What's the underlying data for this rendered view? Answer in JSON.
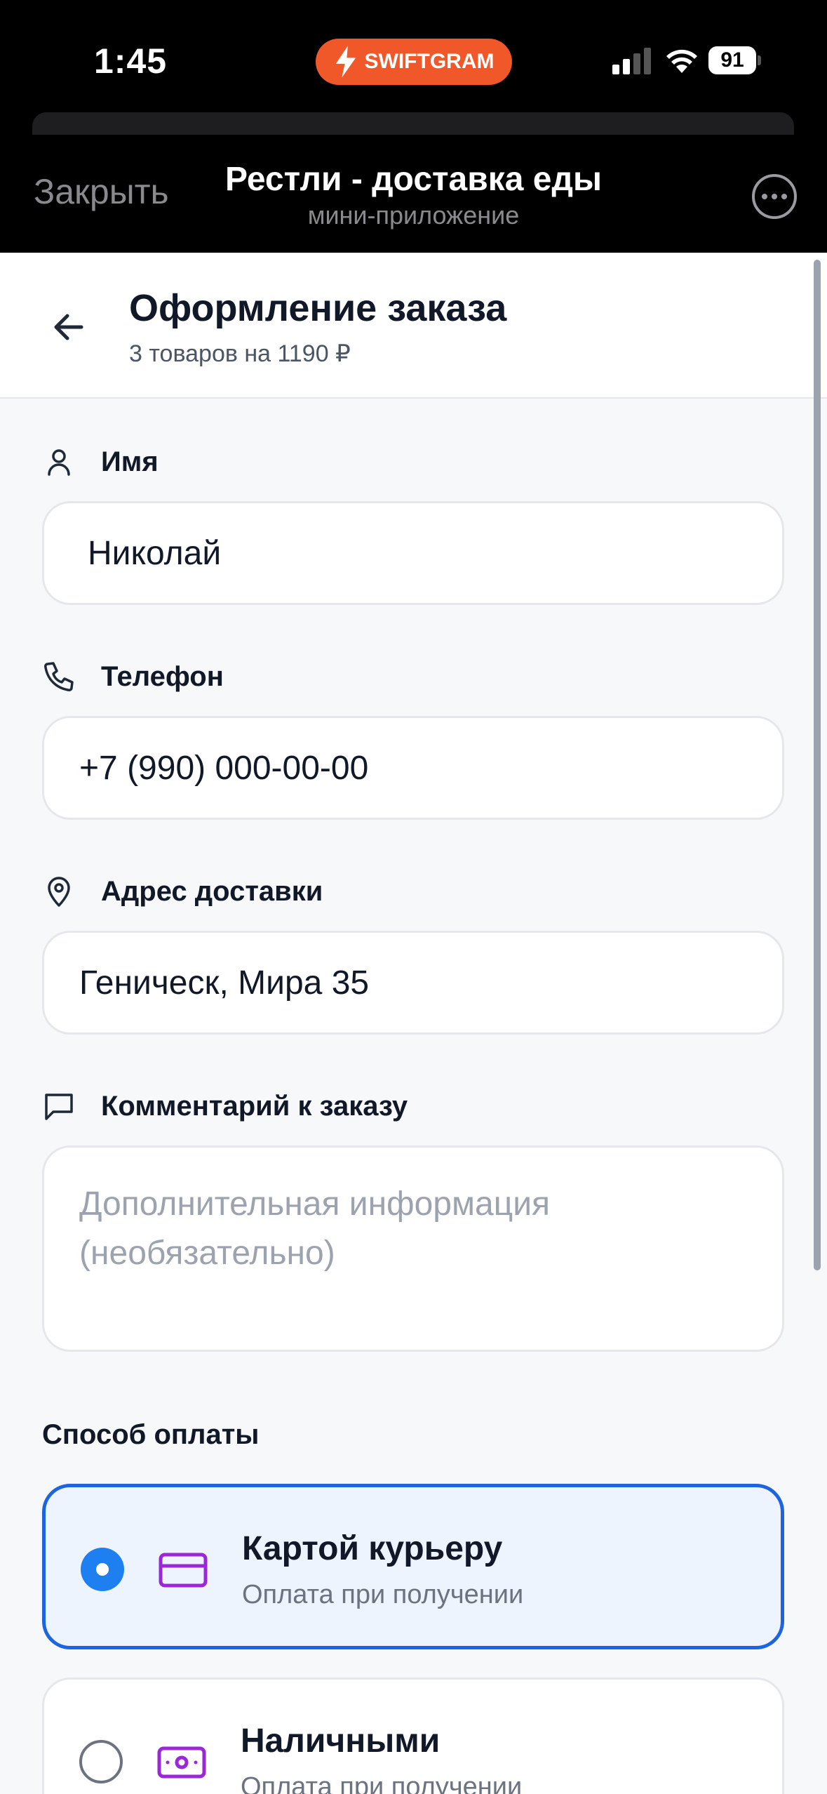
{
  "status_bar": {
    "time": "1:45",
    "badge_label": "SWIFTGRAM",
    "battery": "91"
  },
  "mini_app": {
    "close_label": "Закрыть",
    "title": "Рестли - доставка еды",
    "subtitle": "мини-приложение"
  },
  "page": {
    "title": "Оформление заказа",
    "subtitle": "3 товаров на 1190 ₽"
  },
  "form": {
    "name": {
      "label": "Имя",
      "value": "Николай"
    },
    "phone": {
      "label": "Телефон",
      "value": "+7 (990) 000-00-00"
    },
    "address": {
      "label": "Адрес доставки",
      "value": "Геническ, Мира 35"
    },
    "comment": {
      "label": "Комментарий к заказу",
      "placeholder_line1": "Дополнительная информация",
      "placeholder_line2": "(необязательно)"
    }
  },
  "payment": {
    "title": "Способ оплаты",
    "options": [
      {
        "title": "Картой курьеру",
        "subtitle": "Оплата при получении",
        "selected": true,
        "icon": "credit-card-icon"
      },
      {
        "title": "Наличными",
        "subtitle": "Оплата при получении",
        "selected": false,
        "icon": "cash-icon"
      }
    ]
  },
  "colors": {
    "accent": "#1d64e0",
    "radio_selected": "#1d7ff0",
    "payment_icon": "#9b27d6",
    "swiftgram_badge": "#f0582a"
  }
}
